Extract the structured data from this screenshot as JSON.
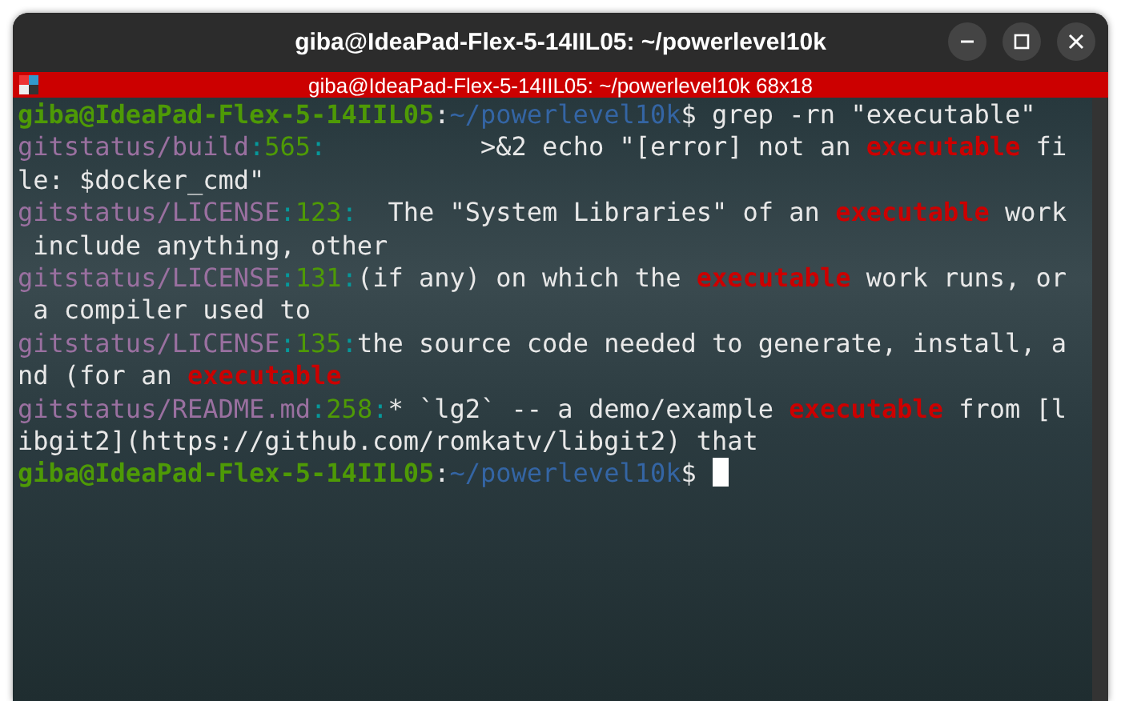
{
  "window": {
    "title": "giba@IdeaPad-Flex-5-14IIL05: ~/powerlevel10k"
  },
  "terminal_bar": {
    "title": "giba@IdeaPad-Flex-5-14IIL05: ~/powerlevel10k 68x18"
  },
  "lines": [
    [
      {
        "kind": "user",
        "text": "giba@IdeaPad-Flex-5-14IIL05"
      },
      {
        "kind": "plain",
        "text": ":"
      },
      {
        "kind": "path",
        "text": "~/powerlevel10k"
      },
      {
        "kind": "plain",
        "text": "$ grep -rn \"executable\""
      }
    ],
    [
      {
        "kind": "file",
        "text": "gitstatus/build"
      },
      {
        "kind": "sep",
        "text": ":"
      },
      {
        "kind": "lineno",
        "text": "565"
      },
      {
        "kind": "sep",
        "text": ":"
      },
      {
        "kind": "plain",
        "text": "          >&2 echo \"[error] not an "
      },
      {
        "kind": "match",
        "text": "executable"
      },
      {
        "kind": "plain",
        "text": " fi"
      }
    ],
    [
      {
        "kind": "plain",
        "text": "le: $docker_cmd\""
      }
    ],
    [
      {
        "kind": "file",
        "text": "gitstatus/LICENSE"
      },
      {
        "kind": "sep",
        "text": ":"
      },
      {
        "kind": "lineno",
        "text": "123"
      },
      {
        "kind": "sep",
        "text": ":"
      },
      {
        "kind": "plain",
        "text": "  The \"System Libraries\" of an "
      },
      {
        "kind": "match",
        "text": "executable"
      },
      {
        "kind": "plain",
        "text": " work"
      }
    ],
    [
      {
        "kind": "plain",
        "text": " include anything, other"
      }
    ],
    [
      {
        "kind": "file",
        "text": "gitstatus/LICENSE"
      },
      {
        "kind": "sep",
        "text": ":"
      },
      {
        "kind": "lineno",
        "text": "131"
      },
      {
        "kind": "sep",
        "text": ":"
      },
      {
        "kind": "plain",
        "text": "(if any) on which the "
      },
      {
        "kind": "match",
        "text": "executable"
      },
      {
        "kind": "plain",
        "text": " work runs, or"
      }
    ],
    [
      {
        "kind": "plain",
        "text": " a compiler used to"
      }
    ],
    [
      {
        "kind": "file",
        "text": "gitstatus/LICENSE"
      },
      {
        "kind": "sep",
        "text": ":"
      },
      {
        "kind": "lineno",
        "text": "135"
      },
      {
        "kind": "sep",
        "text": ":"
      },
      {
        "kind": "plain",
        "text": "the source code needed to generate, install, a"
      }
    ],
    [
      {
        "kind": "plain",
        "text": "nd (for an "
      },
      {
        "kind": "match",
        "text": "executable"
      }
    ],
    [
      {
        "kind": "file",
        "text": "gitstatus/README.md"
      },
      {
        "kind": "sep",
        "text": ":"
      },
      {
        "kind": "lineno",
        "text": "258"
      },
      {
        "kind": "sep",
        "text": ":"
      },
      {
        "kind": "plain",
        "text": "* `lg2` -- a demo/example "
      },
      {
        "kind": "match",
        "text": "executable"
      },
      {
        "kind": "plain",
        "text": " from [l"
      }
    ],
    [
      {
        "kind": "plain",
        "text": "ibgit2](https://github.com/romkatv/libgit2) that"
      }
    ],
    [
      {
        "kind": "user",
        "text": "giba@IdeaPad-Flex-5-14IIL05"
      },
      {
        "kind": "plain",
        "text": ":"
      },
      {
        "kind": "path",
        "text": "~/powerlevel10k"
      },
      {
        "kind": "plain",
        "text": "$ "
      }
    ]
  ]
}
